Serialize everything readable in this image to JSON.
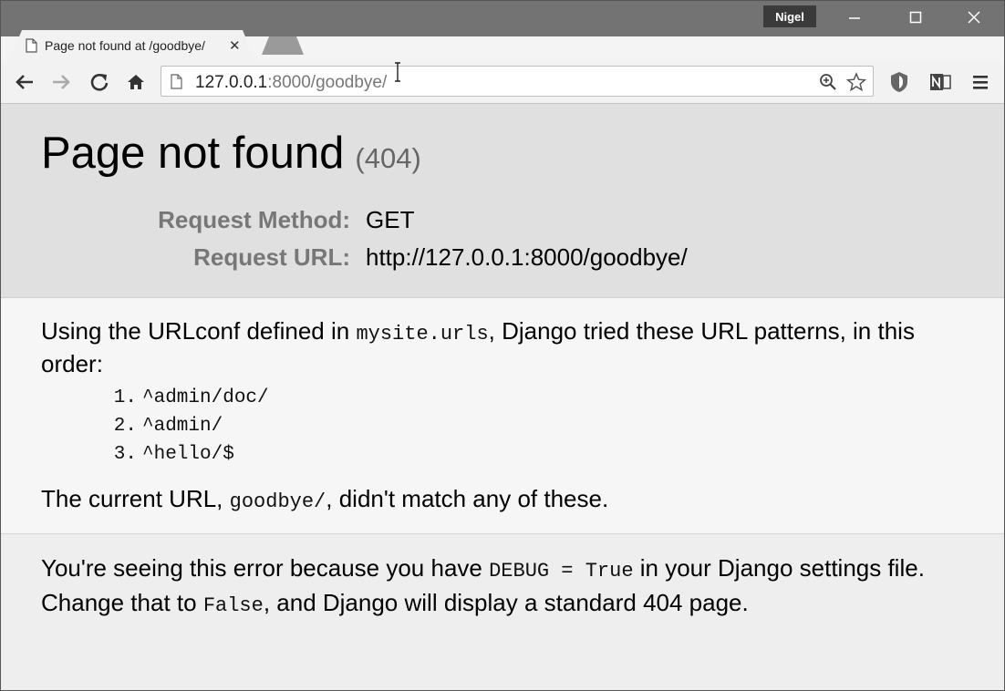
{
  "window": {
    "profile_name": "Nigel",
    "tab_title": "Page not found at /goodbye/",
    "close_glyph": "✕"
  },
  "omnibox": {
    "url_host": "127.0.0.1",
    "url_rest": ":8000/goodbye/"
  },
  "summary": {
    "title": "Page not found",
    "status_code": "(404)",
    "request_method_label": "Request Method:",
    "request_method_value": "GET",
    "request_url_label": "Request URL:",
    "request_url_value": "http://127.0.0.1:8000/goodbye/"
  },
  "info": {
    "intro_before": "Using the URLconf defined in ",
    "urlconf_module": "mysite.urls",
    "intro_after": ", Django tried these URL patterns, in this order:",
    "patterns": [
      {
        "num": "1.",
        "pattern": "^admin/doc/"
      },
      {
        "num": "2.",
        "pattern": "^admin/"
      },
      {
        "num": "3.",
        "pattern": "^hello/$"
      }
    ],
    "mismatch_before": "The current URL, ",
    "current_url": "goodbye/",
    "mismatch_after": ", didn't match any of these."
  },
  "explanation": {
    "part1": "You're seeing this error because you have ",
    "debug_setting": "DEBUG = True",
    "part2": " in your Django settings file. Change that to ",
    "false_value": "False",
    "part3": ", and Django will display a standard 404 page."
  }
}
